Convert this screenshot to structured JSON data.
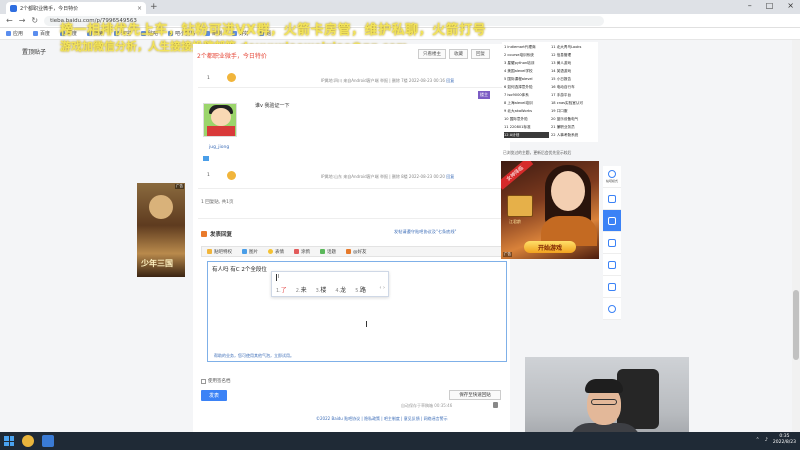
{
  "browser": {
    "tab_title": "2个都职业微手，今日特价",
    "url": "tieba.baidu.com/p/7996549563",
    "bookmarks": [
      "应用",
      "百度",
      "百度",
      "搜索",
      "淘宝",
      "贴吧",
      "吧小宝马",
      "刷刷",
      "好好",
      "题"
    ]
  },
  "overlay": {
    "line1": "榜一相排优先上车，钻粉可进VX群，火箭卡房管，维护私聊，火箭打号",
    "line2": "游戏加微信分析，人生接接投稿邮箱 douyuxiaoweixiao@qq.com"
  },
  "page": {
    "site_title": "置顶贴子",
    "thread_subtitle": "2个都职业微手，今日特价",
    "top_buttons": [
      "只看楼主",
      "收藏",
      "回复"
    ],
    "post1": {
      "level": "1",
      "meta": "IP属地:四川 来自Android客户端 举报 | 删除 7楼 2022-08-23 00:16",
      "reply_link": "回复"
    },
    "post2": {
      "username": "jug_jiong",
      "text": "谁v 我验证一下",
      "level": "1",
      "meta": "IP属地:山东 来自Android客户端 举报 | 删除 8楼 2022-08-23 00:20",
      "reply_link": "回复",
      "tag": "楼主"
    },
    "pager": "1 回复贴, 共1页",
    "reply_section_title": "发表回复",
    "reply_hint": "发帖请遵守贴吧协议及\"七条底线\"",
    "toolbar": [
      "贴吧特权",
      "图片",
      "表情",
      "涂鸦",
      "话题",
      "@好友"
    ],
    "editor_text": "有人吗 有C 2个全段位",
    "editor_footer": "帮助的业务，您可使用其他气泡，立即试用。",
    "ime": {
      "input": "l",
      "candidates": [
        {
          "num": "1.",
          "text": "了"
        },
        {
          "num": "2.",
          "text": "来"
        },
        {
          "num": "3.",
          "text": "楼"
        },
        {
          "num": "4.",
          "text": "龙"
        },
        {
          "num": "5.",
          "text": "路"
        }
      ],
      "nav": "‹ ›"
    },
    "checkbox_label": "使用签名档",
    "send_button": "发表",
    "save_quick": "保存至快速回贴",
    "draft_note": "自动保存于草稿箱 00:35:46",
    "footer": "©2022 Baidu 贴吧协议 | 隐私政策 | 吧主制度 | 意见反馈 | 网络谣言警示"
  },
  "left_ad": {
    "tag": "广告",
    "logo": "少年三国"
  },
  "right_list": [
    "1 indiemart代理商",
    "11 北大青鸟Looks",
    "2 course培训系统",
    "12 信息管理",
    "3 星耀python培训",
    "13 黄人游戏",
    "4 美国alevel学校",
    "14 英语游戏",
    "5 国际课程alevel",
    "15 小日报告",
    "6 如何选择意外险",
    "16 电动自行车",
    "7 iso9000体系",
    "17 手游平台",
    "8 上海alevel培训",
    "18 cnas实验室认可",
    "9 北大akaWorks",
    "19 口口服",
    "10 国际意外险",
    "20 蓝乐设备电气",
    "11 220801标准",
    "21 兼职业务员",
    "12 A计划",
    "22 人事考勤系统"
  ],
  "right_note": "已浏览过的主题，更新后会优先显示较后",
  "right_ad": {
    "ribbon": "女神降临",
    "name": "江君龄",
    "cta": "开始游戏",
    "tag": "广告"
  },
  "side_rail": [
    "帖吧模式",
    "",
    "",
    "",
    "",
    "",
    ""
  ],
  "taskbar": {
    "time": "0:35",
    "date": "2022/8/23"
  }
}
